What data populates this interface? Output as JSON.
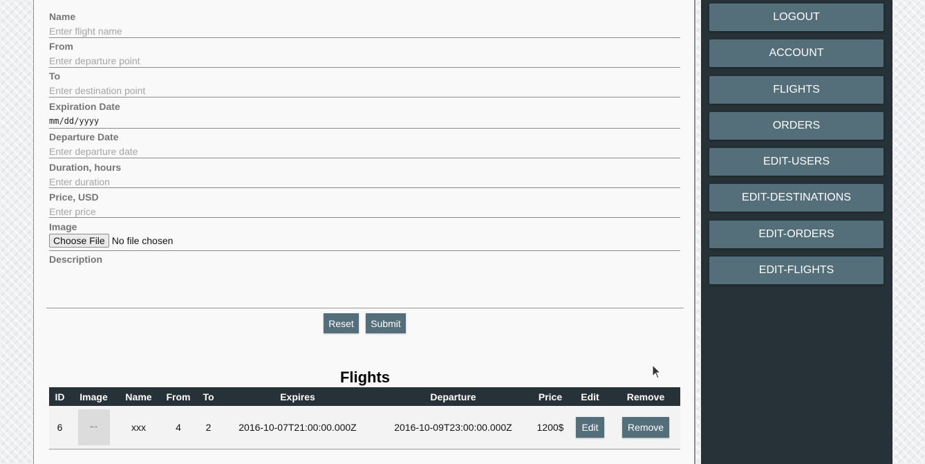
{
  "form": {
    "fields": [
      {
        "label": "Name",
        "placeholder": "Enter flight name"
      },
      {
        "label": "From",
        "placeholder": "Enter departure point"
      },
      {
        "label": "To",
        "placeholder": "Enter destination point"
      },
      {
        "label": "Expiration Date",
        "value": "mm/dd/yyyy"
      },
      {
        "label": "Departure Date",
        "placeholder": "Enter departure date"
      },
      {
        "label": "Duration, hours",
        "placeholder": "Enter duration"
      },
      {
        "label": "Price, USD",
        "placeholder": "Enter price"
      },
      {
        "label": "Image",
        "file_button": "Choose File",
        "file_status": "No file chosen"
      },
      {
        "label": "Description"
      }
    ],
    "reset_label": "Reset",
    "submit_label": "Submit"
  },
  "flights": {
    "title": "Flights",
    "columns": [
      "ID",
      "Image",
      "Name",
      "From",
      "To",
      "Expires",
      "Departure",
      "Price",
      "Edit",
      "Remove"
    ],
    "rows": [
      {
        "id": "6",
        "image_text": "••• ••",
        "name": "xxx",
        "from": "4",
        "to": "2",
        "expires": "2016-10-07T21:00:00.000Z",
        "departure": "2016-10-09T23:00:00.000Z",
        "price": "1200$",
        "edit_label": "Edit",
        "remove_label": "Remove"
      }
    ]
  },
  "sidebar": {
    "items": [
      {
        "label": "LOGOUT"
      },
      {
        "label": "ACCOUNT"
      },
      {
        "label": "FLIGHTS"
      },
      {
        "label": "ORDERS"
      },
      {
        "label": "EDIT-USERS"
      },
      {
        "label": "EDIT-DESTINATIONS"
      },
      {
        "label": "EDIT-ORDERS"
      },
      {
        "label": "EDIT-FLIGHTS"
      }
    ]
  },
  "colors": {
    "button": "#546e7a",
    "sidebar_bg": "#263238",
    "table_header": "#263238"
  },
  "icons": {
    "cursor": "mouse-pointer-icon"
  }
}
